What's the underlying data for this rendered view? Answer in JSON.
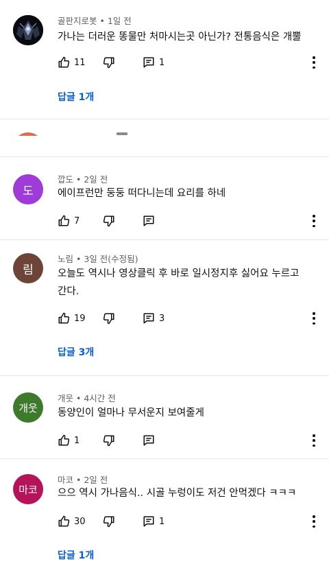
{
  "comments": [
    {
      "author": "골판지로봇",
      "time": "• 1일 전",
      "text": "가나는 더러운 똥물만 처마시는곳 아닌가? 전통음식은 개뿔",
      "likes": "11",
      "replies_count": "1",
      "replies_link": "답글 1개",
      "avatar_icon": "robot-avatar-image"
    },
    {
      "author": "깝도",
      "time": "• 2일 전",
      "text": "에이프런만 둥둥 떠다니는데 요리를 하네",
      "likes": "7",
      "avatar_text": "도",
      "avatar_color": "#9f3bd6"
    },
    {
      "author": "노림",
      "time": "• 3일 전(수정됨)",
      "text": "오늘도 역시나 영상클릭 후 바로 일시정지후 싫어요 누르고 간다.",
      "likes": "19",
      "replies_count": "3",
      "replies_link": "답글 3개",
      "avatar_text": "림",
      "avatar_color": "#6d4437"
    },
    {
      "author": "개웃",
      "time": "• 4시간 전",
      "text": "동양인이 얼마나 무서운지 보여줄게",
      "likes": "1",
      "avatar_text": "개웃",
      "avatar_color": "#3d7a2b"
    },
    {
      "author": "마코",
      "time": "• 2일 전",
      "text": "으으 역시 가나음식.. 시골 누렁이도 저건 안먹겠다 ㅋㅋㅋ",
      "likes": "30",
      "replies_count": "1",
      "replies_link": "답글 1개",
      "avatar_text": "마코",
      "avatar_color": "#b5135a"
    }
  ],
  "icons": {
    "like": "thumbs-up-icon",
    "dislike": "thumbs-down-icon",
    "reply": "comment-reply-icon",
    "more": "more-vertical-icon"
  },
  "colors": {
    "link": "#065fd4",
    "meta": "#606060",
    "divider": "#e5e5e5"
  }
}
